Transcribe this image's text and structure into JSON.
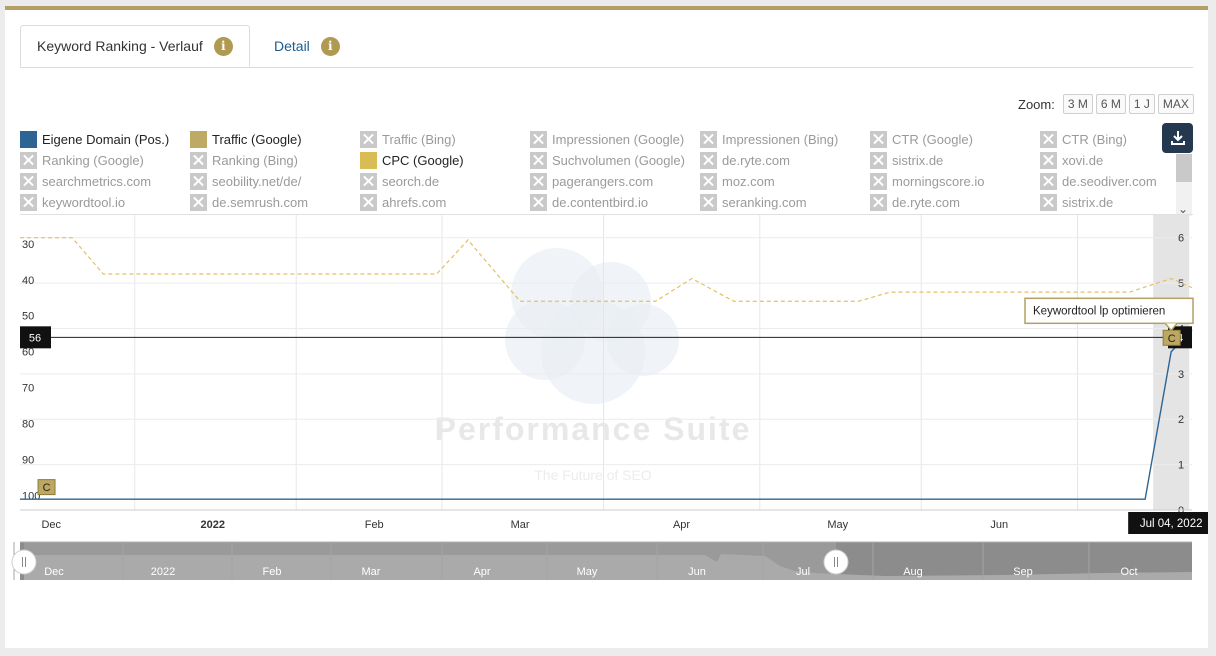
{
  "tabs": [
    {
      "label": "Keyword Ranking - Verlauf",
      "info": "i"
    },
    {
      "label": "Detail",
      "info": "i"
    }
  ],
  "zoom": {
    "label": "Zoom:",
    "options": [
      "3 M",
      "6 M",
      "1 J",
      "MAX"
    ]
  },
  "legend": [
    {
      "label": "Eigene Domain (Pos.)",
      "enabled": true,
      "color": "#2c6594"
    },
    {
      "label": "Traffic (Google)",
      "enabled": true,
      "color": "#bdaa66"
    },
    {
      "label": "Traffic (Bing)",
      "enabled": false
    },
    {
      "label": "Impressionen (Google)",
      "enabled": false
    },
    {
      "label": "Impressionen (Bing)",
      "enabled": false
    },
    {
      "label": "CTR (Google)",
      "enabled": false
    },
    {
      "label": "CTR (Bing)",
      "enabled": false
    },
    {
      "label": "Ranking (Google)",
      "enabled": false
    },
    {
      "label": "Ranking (Bing)",
      "enabled": false
    },
    {
      "label": "CPC (Google)",
      "enabled": true,
      "color": "#d9bc53"
    },
    {
      "label": "Suchvolumen (Google)",
      "enabled": false
    },
    {
      "label": "de.ryte.com",
      "enabled": false
    },
    {
      "label": "sistrix.de",
      "enabled": false
    },
    {
      "label": "xovi.de",
      "enabled": false
    },
    {
      "label": "searchmetrics.com",
      "enabled": false
    },
    {
      "label": "seobility.net/de/",
      "enabled": false
    },
    {
      "label": "seorch.de",
      "enabled": false
    },
    {
      "label": "pagerangers.com",
      "enabled": false
    },
    {
      "label": "moz.com",
      "enabled": false
    },
    {
      "label": "morningscore.io",
      "enabled": false
    },
    {
      "label": "de.seodiver.com",
      "enabled": false
    },
    {
      "label": "keywordtool.io",
      "enabled": false
    },
    {
      "label": "de.semrush.com",
      "enabled": false
    },
    {
      "label": "ahrefs.com",
      "enabled": false
    },
    {
      "label": "de.contentbird.io",
      "enabled": false
    },
    {
      "label": "seranking.com",
      "enabled": false
    },
    {
      "label": "de.ryte.com",
      "enabled": false
    },
    {
      "label": "sistrix.de",
      "enabled": false
    }
  ],
  "watermark": {
    "title": "Performance Suite",
    "subtitle": "The Future of SEO"
  },
  "chart_data": {
    "type": "line",
    "x_axis": {
      "type": "date",
      "range": [
        "2021-11-25",
        "2022-07-08"
      ],
      "ticks": [
        {
          "date": "2021-12-01",
          "label": "Dec",
          "bold": false
        },
        {
          "date": "2022-01-01",
          "label": "2022",
          "bold": true
        },
        {
          "date": "2022-02-01",
          "label": "Feb",
          "bold": false
        },
        {
          "date": "2022-03-01",
          "label": "Mar",
          "bold": false
        },
        {
          "date": "2022-04-01",
          "label": "Apr",
          "bold": false
        },
        {
          "date": "2022-05-01",
          "label": "May",
          "bold": false
        },
        {
          "date": "2022-06-01",
          "label": "Jun",
          "bold": false
        },
        {
          "date": "2022-07-01",
          "label": "Jul",
          "bold": false
        }
      ]
    },
    "y_left": {
      "reversed": true,
      "range": [
        22,
        104
      ],
      "ticks": [
        30,
        40,
        50,
        60,
        70,
        80,
        90,
        100
      ]
    },
    "y_right": {
      "range": [
        0,
        6.5
      ],
      "ticks": [
        0,
        1,
        2,
        3,
        4,
        5,
        6
      ]
    },
    "series": [
      {
        "name": "Eigene Domain (Pos.)",
        "axis": "left",
        "color": "#2c6594",
        "style": "solid",
        "points": [
          [
            "2021-11-25",
            101
          ],
          [
            "2022-06-29",
            101
          ],
          [
            "2022-07-04",
            60
          ],
          [
            "2022-07-08",
            54
          ]
        ]
      },
      {
        "name": "CPC (Google)",
        "axis": "right",
        "color": "#e3c064",
        "style": "dashed",
        "points": [
          [
            "2021-11-25",
            6
          ],
          [
            "2021-12-05",
            6
          ],
          [
            "2021-12-11",
            5.2
          ],
          [
            "2022-02-13",
            5.2
          ],
          [
            "2022-02-19",
            5.95
          ],
          [
            "2022-03-01",
            4.6
          ],
          [
            "2022-03-27",
            4.6
          ],
          [
            "2022-04-03",
            5.1
          ],
          [
            "2022-04-11",
            4.6
          ],
          [
            "2022-05-05",
            4.6
          ],
          [
            "2022-05-11",
            4.8
          ],
          [
            "2022-06-26",
            4.8
          ],
          [
            "2022-07-04",
            5.1
          ],
          [
            "2022-07-08",
            4.9
          ]
        ]
      }
    ],
    "crosshair": {
      "left_value": "56",
      "right_value": "4"
    },
    "highlight": {
      "date": "2022-07-04",
      "label": "Jul 04, 2022"
    },
    "flags": [
      {
        "date": "2021-11-30",
        "letter": "C",
        "y": 97.5
      },
      {
        "date": "2022-07-04",
        "letter": "C",
        "y": 56,
        "tooltip": "Keywordtool lp optimieren"
      }
    ]
  },
  "navigator": {
    "labels": [
      "Dec",
      "2022",
      "Feb",
      "Mar",
      "Apr",
      "May",
      "Jun",
      "Jul",
      "Aug",
      "Sep",
      "Oct"
    ]
  }
}
